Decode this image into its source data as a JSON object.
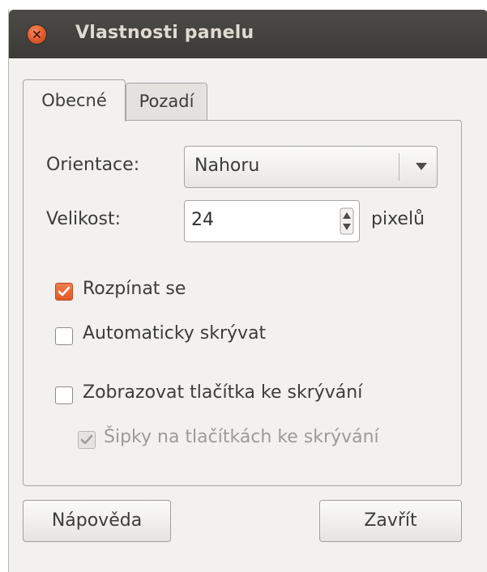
{
  "window": {
    "title": "Vlastnosti panelu"
  },
  "tabs": [
    {
      "label": "Obecné",
      "active": true
    },
    {
      "label": "Pozadí",
      "active": false
    }
  ],
  "orientation": {
    "label": "Orientace:",
    "value": "Nahoru"
  },
  "size": {
    "label": "Velikost:",
    "value": "24",
    "unit": "pixelů"
  },
  "checkboxes": {
    "expand": {
      "label": "Rozpínat se",
      "checked": true
    },
    "autohide": {
      "label": "Automaticky skrývat",
      "checked": false
    },
    "hide_buttons": {
      "label": "Zobrazovat tlačítka ke skrývání",
      "checked": false
    },
    "arrows": {
      "label": "Šipky na tlačítkách ke skrývání",
      "checked": true,
      "enabled": false
    }
  },
  "buttons": {
    "help": "Nápověda",
    "close": "Zavřít"
  },
  "colors": {
    "accent": "#e05a26",
    "titlebar": "#3c3b37"
  }
}
